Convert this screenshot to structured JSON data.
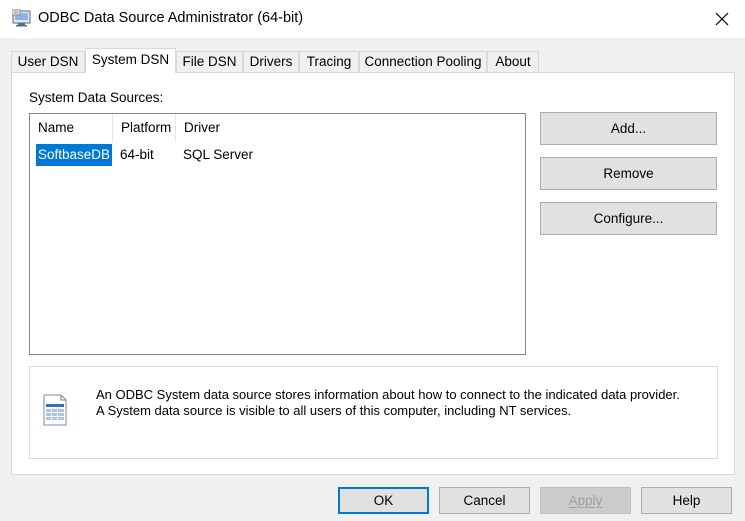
{
  "window": {
    "title": "ODBC Data Source Administrator (64-bit)",
    "close_glyph": "✕"
  },
  "tabs": [
    {
      "label": "User DSN"
    },
    {
      "label": "System DSN",
      "active": true
    },
    {
      "label": "File DSN"
    },
    {
      "label": "Drivers"
    },
    {
      "label": "Tracing"
    },
    {
      "label": "Connection Pooling"
    },
    {
      "label": "About"
    }
  ],
  "system_dsn": {
    "group_label": "System Data Sources:",
    "columns": [
      "Name",
      "Platform",
      "Driver"
    ],
    "rows": [
      {
        "name": "SoftbaseDB",
        "platform": "64-bit",
        "driver": "SQL Server",
        "selected": true
      }
    ],
    "buttons": {
      "add": "Add...",
      "remove": "Remove",
      "configure": "Configure..."
    },
    "info": {
      "icon": "data-source-icon",
      "line1": "An ODBC System data source stores information about how to connect to the indicated data provider.",
      "line2": "A System data source is visible to all users of this computer, including NT services."
    }
  },
  "dialog_buttons": {
    "ok": "OK",
    "cancel": "Cancel",
    "apply": "Apply",
    "help": "Help"
  },
  "colors": {
    "selection": "#0078d7",
    "button_face": "#e1e1e1",
    "dialog_bg": "#f0f0f0"
  }
}
